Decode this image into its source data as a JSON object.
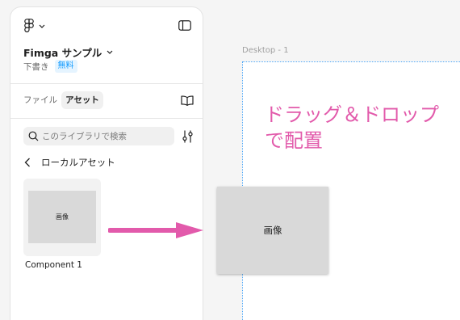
{
  "sidebar": {
    "header": {
      "menu_icon": "figma-logo-icon",
      "menu_chevron_icon": "chevron-down-icon",
      "toggle_icon": "sidebar-toggle-icon"
    },
    "project": {
      "name": "Fimga サンプル",
      "name_chevron_icon": "chevron-down-icon",
      "location": "下書き",
      "plan_badge": "無料"
    },
    "tabs": [
      {
        "label": "ファイル",
        "active": false
      },
      {
        "label": "アセット",
        "active": true
      }
    ],
    "library_icon": "book-icon",
    "search": {
      "icon": "search-icon",
      "placeholder": "このライブラリで検索"
    },
    "filter_icon": "sliders-icon",
    "breadcrumb": {
      "back_icon": "chevron-left-icon",
      "label": "ローカルアセット"
    },
    "assets": [
      {
        "thumbnail_text": "画像",
        "name": "Component 1"
      }
    ]
  },
  "canvas": {
    "frame": {
      "label": "Desktop - 1"
    },
    "annotation": {
      "lines": [
        "ドラッグ＆ドロップ",
        "で配置"
      ],
      "arrow_icon": "arrow-right-icon"
    },
    "dropped_image": {
      "text": "画像"
    }
  },
  "colors": {
    "accent": "#0d99ff",
    "badge_bg": "#e5f4ff",
    "annotation": "#e25aab",
    "frame_border": "#4ea6f5",
    "canvas_bg": "#f5f5f5",
    "image_fill": "#d9d9d9"
  }
}
